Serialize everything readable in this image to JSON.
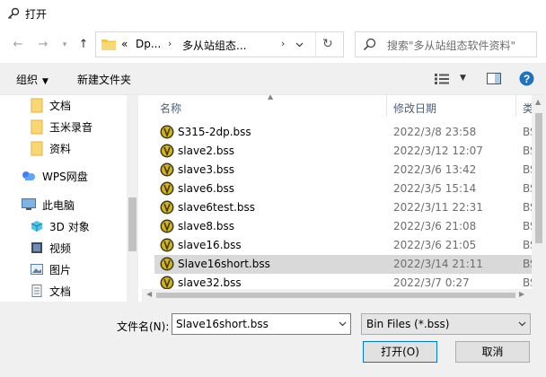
{
  "window": {
    "title": "打开"
  },
  "nav": {
    "breadcrumb_overflow": "«",
    "crumbs": [
      "Dp...",
      "多从站组态..."
    ],
    "search_placeholder": "搜索\"多从站组态软件资料\""
  },
  "toolbar": {
    "organize_label": "组织",
    "new_folder_label": "新建文件夹"
  },
  "sidebar": {
    "items": [
      {
        "label": "文档",
        "icon": "folder-icon"
      },
      {
        "label": "玉米录音",
        "icon": "folder-icon"
      },
      {
        "label": "资料",
        "icon": "folder-icon"
      },
      {
        "label": "WPS网盘",
        "icon": "cloud-icon"
      },
      {
        "label": "此电脑",
        "icon": "computer-icon"
      },
      {
        "label": "3D 对象",
        "icon": "3d-objects-icon"
      },
      {
        "label": "视频",
        "icon": "video-icon"
      },
      {
        "label": "图片",
        "icon": "pictures-icon"
      },
      {
        "label": "文档",
        "icon": "documents-icon"
      }
    ]
  },
  "filelist": {
    "columns": {
      "name": "名称",
      "date": "修改日期",
      "type": "类"
    },
    "rows": [
      {
        "name": "S315-2dp.bss",
        "date": "2022/3/8 23:58",
        "type": "BS"
      },
      {
        "name": "slave2.bss",
        "date": "2022/3/12 12:07",
        "type": "BS"
      },
      {
        "name": "slave3.bss",
        "date": "2022/3/6 13:42",
        "type": "BS"
      },
      {
        "name": "slave6.bss",
        "date": "2022/3/5 15:14",
        "type": "BS"
      },
      {
        "name": "slave6test.bss",
        "date": "2022/3/11 22:31",
        "type": "BS"
      },
      {
        "name": "slave8.bss",
        "date": "2022/3/6 21:08",
        "type": "BS"
      },
      {
        "name": "slave16.bss",
        "date": "2022/3/6 21:05",
        "type": "BS"
      },
      {
        "name": "Slave16short.bss",
        "date": "2022/3/14 21:11",
        "type": "BS"
      },
      {
        "name": "slave32.bss",
        "date": "2022/3/7 0:27",
        "type": "BS"
      }
    ],
    "selected_index": 7
  },
  "footer": {
    "filename_label": "文件名(N):",
    "filename_value": "Slave16short.bss",
    "filetype_value": "Bin Files (*.bss)",
    "open_label": "打开(O)",
    "cancel_label": "取消"
  },
  "colors": {
    "accent": "#0078d7",
    "folder": "#f5c542",
    "help": "#1e73be",
    "selection": "#d9d9d9"
  }
}
